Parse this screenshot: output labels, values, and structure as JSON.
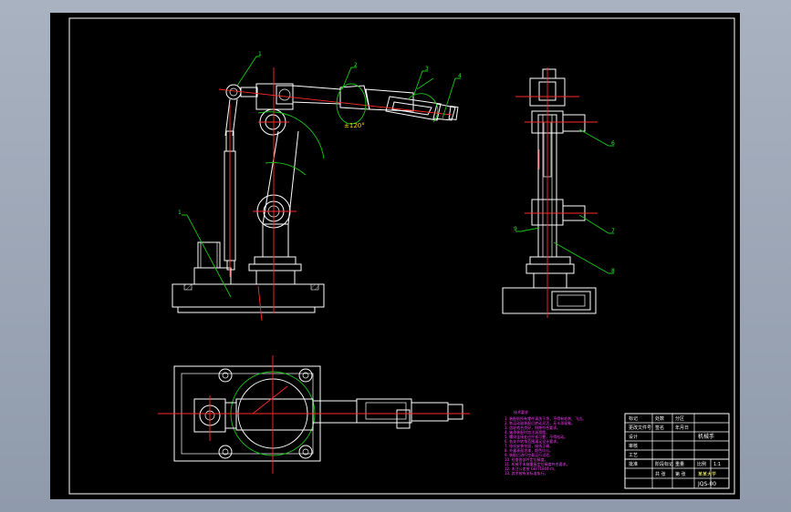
{
  "drawing": {
    "angle_label": "±120°",
    "leaders": {
      "top_1": "1",
      "top_2": "2",
      "top_3": "3",
      "top_4": "4",
      "front_left": "1",
      "side_6": "6",
      "side_7": "7",
      "side_8": "8",
      "side_9": "9"
    },
    "notes_title": "技术要求",
    "notes_lines": [
      "1. 装配前所有零件清洗干净，不得有毛刺、飞边。",
      "2. 各运动副装配后转动灵活，无卡滞现象。",
      "3. 齿轮啮合良好，侧隙符合要求。",
      "4. 轴承装配时加注润滑脂。",
      "5. 螺纹连接处应拧紧可靠，不得松动。",
      "6. 各关节转角范围满足设计要求。",
      "7. 电机安装牢固，接线正确。",
      "8. 外露表面涂漆，颜色均匀。",
      "9. 装配后进行空载运行试验。",
      "10. 检查各部件定位精度。",
      "11. 机械手末端重复定位精度符合要求。",
      "12. 未注公差按 GB/T1804-m。",
      "13. 其余按有关标准执行。"
    ],
    "title_block": {
      "name": "机械手",
      "school": "某某大学",
      "drawing_no": "JQS-00",
      "cells": [
        "标记",
        "处数",
        "分区",
        "更改文件号",
        "签名",
        "年月日",
        "设计",
        "审核",
        "工艺",
        "批准",
        "阶段标记",
        "重量",
        "比例",
        "1:1",
        "共 张",
        "第 张"
      ]
    }
  }
}
